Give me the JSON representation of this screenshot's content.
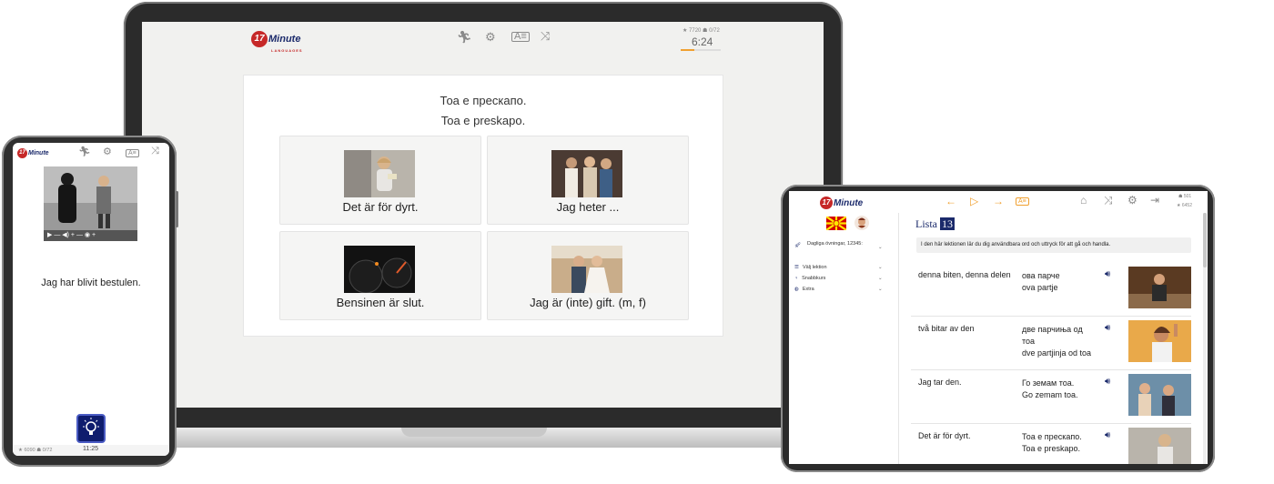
{
  "brand": {
    "logo_number": "17",
    "logo_word": "Minute",
    "logo_sub": "LANGUAGES"
  },
  "colors": {
    "accent": "#f0a030",
    "brand_blue": "#1b2a6b",
    "brand_red": "#c62828"
  },
  "laptop": {
    "toolbar_icons": [
      "runner-icon",
      "gear-icon",
      "card-icon",
      "crossed-arrows-icon"
    ],
    "stats": "★ 7720 ☗ 0/72",
    "timer": "6:24",
    "progress": 0.35,
    "quiz": {
      "prompt_cyrillic": "Тоа е прескапо.",
      "prompt_latin": "Toa e preskapo.",
      "options": [
        {
          "label": "Det är för dyrt."
        },
        {
          "label": "Jag heter ..."
        },
        {
          "label": "Bensinen är slut."
        },
        {
          "label": "Jag är (inte) gift. (m, f)"
        }
      ]
    }
  },
  "phone": {
    "toolbar_icons": [
      "runner-icon",
      "gear-icon",
      "card-icon",
      "crossed-arrows-icon"
    ],
    "video_controls": "▶ — ◀) + — ◉ +",
    "sentence": "Jag har blivit bestulen.",
    "stats": "★ 6090 ☗ 0/72",
    "time": "11:25",
    "hint_icon": "lightbulb-icon"
  },
  "tablet": {
    "nav_icons": [
      "arrow-left-icon",
      "play-icon",
      "arrow-right-icon",
      "card-icon"
    ],
    "right_icons": [
      "home-icon",
      "crossed-arrows-icon",
      "gear-icon",
      "logout-icon"
    ],
    "stats_top": "☗ 501",
    "stats_bottom": "★ 6452",
    "sidebar": [
      {
        "label": "Dagliga övningar, 12345:",
        "icon": "rocket-icon"
      },
      {
        "label": "Välj lektion",
        "icon": "list-icon"
      },
      {
        "label": "Snabbkurs",
        "icon": "bulb-icon"
      },
      {
        "label": "Extra",
        "icon": "globe-icon"
      }
    ],
    "list_title": "Lista",
    "list_number": "13",
    "intro": "I den här lektionen lär du dig användbara ord och uttryck för att gå och handla.",
    "rows": [
      {
        "sv": "denna biten, denna delen",
        "mk_cyr": "ова парче",
        "mk_lat": "ova partje"
      },
      {
        "sv": "två bitar av den",
        "mk_cyr": "две парчиња од тоа",
        "mk_lat": "dve partjinja od toa"
      },
      {
        "sv": "Jag tar den.",
        "mk_cyr": "Го земам тоа.",
        "mk_lat": "Go zemam toa."
      },
      {
        "sv": "Det är för dyrt.",
        "mk_cyr": "Тоа е прескапо.",
        "mk_lat": "Toa e preskapo."
      }
    ]
  }
}
